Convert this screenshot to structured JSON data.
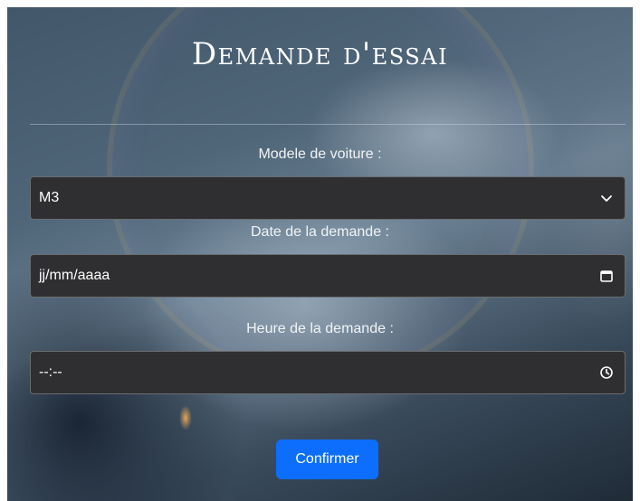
{
  "form": {
    "title": "Demande d'essai",
    "model_label": "Modele de voiture :",
    "model_value": "M3",
    "date_label": "Date de la demande :",
    "date_placeholder": "jj/mm/aaaa",
    "time_label": "Heure de la demande :",
    "time_placeholder": "--:--",
    "submit_label": "Confirmer"
  },
  "icons": {
    "model_dropdown": "chevron-down-icon",
    "date_picker": "calendar-icon",
    "time_picker": "clock-icon"
  },
  "colors": {
    "field_background": "#2f2f31",
    "button_primary": "#0d6efd",
    "text": "#ffffff"
  }
}
